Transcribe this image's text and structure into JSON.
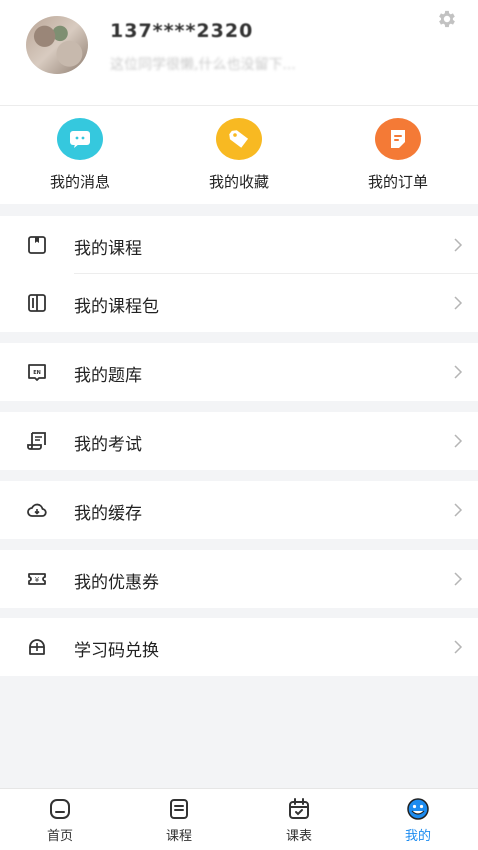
{
  "profile": {
    "phone": "137****2320",
    "motto": "这位同学很懒,什么也没留下...",
    "settings_icon": "gear-icon"
  },
  "quick_actions": [
    {
      "label": "我的消息",
      "icon": "message-icon",
      "color": "#35c8de"
    },
    {
      "label": "我的收藏",
      "icon": "tag-icon",
      "color": "#f8b922"
    },
    {
      "label": "我的订单",
      "icon": "order-icon",
      "color": "#f47a36"
    }
  ],
  "menu": [
    {
      "label": "我的课程",
      "icon": "book-icon"
    },
    {
      "label": "我的课程包",
      "icon": "package-icon"
    },
    {
      "label": "我的题库",
      "icon": "question-bank-icon"
    },
    {
      "label": "我的考试",
      "icon": "exam-icon"
    },
    {
      "label": "我的缓存",
      "icon": "cloud-download-icon"
    },
    {
      "label": "我的优惠券",
      "icon": "coupon-icon"
    },
    {
      "label": "学习码兑换",
      "icon": "redeem-code-icon"
    }
  ],
  "tabbar": {
    "items": [
      {
        "label": "首页",
        "icon": "home-icon"
      },
      {
        "label": "课程",
        "icon": "course-icon"
      },
      {
        "label": "课表",
        "icon": "calendar-icon"
      },
      {
        "label": "我的",
        "icon": "mine-icon"
      }
    ],
    "active_index": 3,
    "active_color": "#1d8cf0"
  }
}
